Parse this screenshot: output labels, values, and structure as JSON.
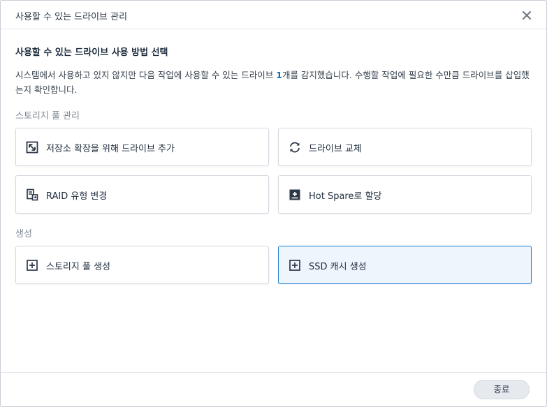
{
  "dialog": {
    "title": "사용할 수 있는 드라이브 관리",
    "heading": "사용할 수 있는 드라이브 사용 방법 선택",
    "desc_before": "시스템에서 사용하고 있지 않지만 다음 작업에 사용할 수 있는 드라이브 ",
    "desc_count": "1",
    "desc_after": "개를 감지했습니다. 수행할 작업에 필요한 수만큼 드라이브를 삽입했는지 확인합니다.",
    "close_label": "종료"
  },
  "sections": {
    "storage_pool": "스토리지 풀 관리",
    "create": "생성"
  },
  "options": {
    "expand": "저장소 확장을 위해 드라이브 추가",
    "replace": "드라이브 교체",
    "raid": "RAID 유형 변경",
    "hotspare": "Hot Spare로 할당",
    "create_pool": "스토리지 풀 생성",
    "ssd_cache": "SSD 캐시 생성"
  },
  "colors": {
    "accent": "#1a7fd4",
    "selected_bg": "#eef5fd"
  },
  "selected_option": "ssd_cache"
}
